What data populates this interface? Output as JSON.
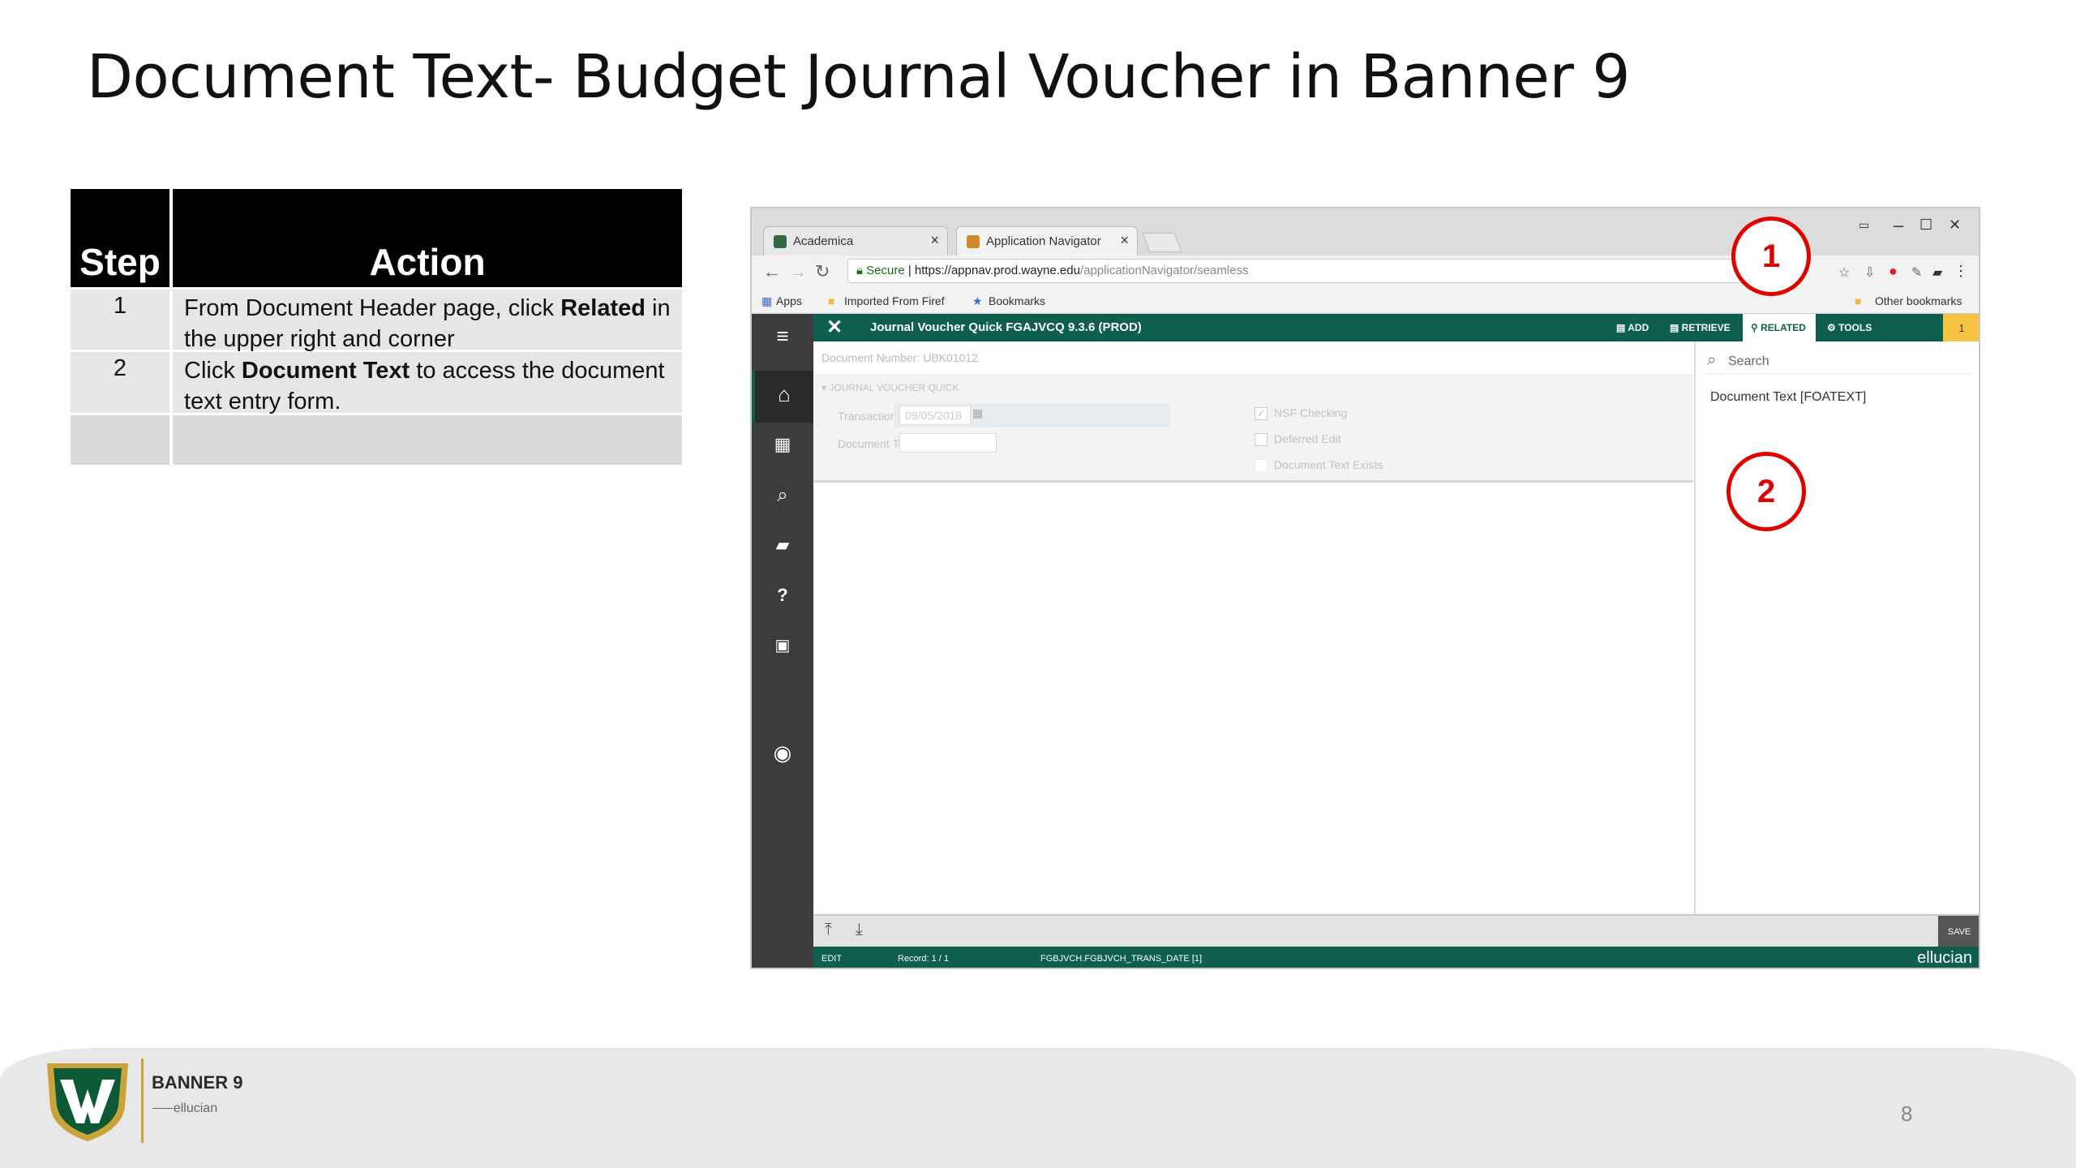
{
  "slide": {
    "title": "Document Text- Budget Journal Voucher in Banner 9",
    "page_number": "8"
  },
  "table": {
    "headers": {
      "step": "Step",
      "action": "Action"
    },
    "rows": [
      {
        "step": "1",
        "pre": "From Document Header page, click ",
        "bold": "Related",
        "post": " in the upper right and corner"
      },
      {
        "step": "2",
        "pre": "Click ",
        "bold": "Document Text",
        "post": " to access the document text entry form."
      }
    ]
  },
  "browser": {
    "tabs": [
      {
        "label": "Academica"
      },
      {
        "label": "Application Navigator"
      }
    ],
    "window_controls": {
      "minimize": "–",
      "maximize": "☐",
      "close": "✕"
    },
    "address": {
      "secure_label": "Secure",
      "url_host": "https://appnav.prod.wayne.edu",
      "url_path": "/applicationNavigator/seamless"
    },
    "bookmarks": {
      "apps": "Apps",
      "imported": "Imported From Firef",
      "bookmarks": "Bookmarks",
      "other": "Other bookmarks"
    }
  },
  "banner": {
    "header_title": "Journal Voucher Quick FGAJVCQ 9.3.6 (PROD)",
    "buttons": {
      "add": "ADD",
      "retrieve": "RETRIEVE",
      "related": "RELATED",
      "tools": "TOOLS"
    },
    "badge": "1",
    "document_number_label": "Document Number:",
    "document_number": "UBK01012",
    "section_title": "JOURNAL VOUCHER QUICK",
    "transaction_date_label": "Transaction Date *",
    "transaction_date": "09/05/2018",
    "document_total_label": "Document Total",
    "checkboxes": {
      "nsf": "NSF Checking",
      "deferred": "Deferred Edit",
      "doc_text_exists": "Document Text Exists"
    },
    "related_panel": {
      "search_placeholder": "Search",
      "item": "Document Text [FOATEXT]"
    },
    "footer": {
      "save": "SAVE"
    },
    "status": {
      "mode": "EDIT",
      "record": "Record: 1 / 1",
      "field": "FGBJVCH.FGBJVCH_TRANS_DATE [1]",
      "brand": "ellucian"
    }
  },
  "callouts": {
    "one": "1",
    "two": "2"
  },
  "logo": {
    "title": "BANNER 9",
    "subtitle": "ellucian"
  },
  "colors": {
    "banner_green": "#0e5f4d",
    "callout_red": "#e00000",
    "nav_dark": "#3c3c3c"
  }
}
